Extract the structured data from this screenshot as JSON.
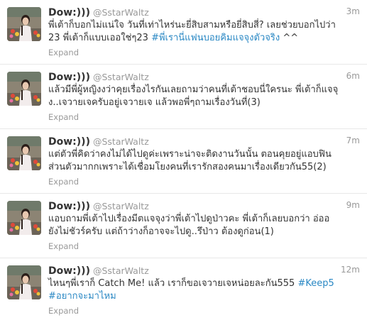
{
  "tweets": [
    {
      "fullname": "Dow:)))",
      "username": "@SstarWaltz",
      "time": "3m",
      "text_line1": "พี่เต้าก็บอกไม่แน่ใจ วันที่เท่าไหร่นะยี่สิบสามหรือยี่สิบสี่? เลยช่วยบอกไปว่า",
      "text_line2": "23 พี่เต้าก็แบบเออใช่ๆ23 ",
      "hashtag": "#พี่เรานี่แฟนบอยคิมแจจุงตัวจริง",
      "text_after": " ^^",
      "expand": "Expand"
    },
    {
      "fullname": "Dow:)))",
      "username": "@SstarWaltz",
      "time": "6m",
      "text_line1": "แล้วมีพี่ผู้หญิงงว่าคุยเรื่องไรกันเลยถามว่าคนที่เต้าชอบนี่ใครนะ พี่เต้าก็แจจุ",
      "text_line2": "ง..เจวายเจครับอยู่เจวายเจ แล้วพอพี่ๆถามเรื่องวันที่(3)",
      "expand": "Expand"
    },
    {
      "fullname": "Dow:)))",
      "username": "@SstarWaltz",
      "time": "7m",
      "text_line1": "แต่ตัวพี่คิดว่าคงไม่ได้ไปดูค่ะเพราะน่าจะติดงานวันนั้น ตอนคุยอยู่แอบฟิน",
      "text_line2": "ส่วนตัวมากกเพราะได้เชื่อมโยงคนที่เรารักสองคนมาเรื่องเดียวกัน55(2)",
      "expand": "Expand"
    },
    {
      "fullname": "Dow:)))",
      "username": "@SstarWaltz",
      "time": "9m",
      "text_line1": "แอบถามพี่เต้าไปเรื่องมีตแจจุงว่าพี่เต้าไปดูป่าวคะ พี่เต้าก็เลยบอกว่า อ่ออ",
      "text_line2": "ยังไม่ชัวร์ครับ แต่ถ้าว่างก็อาจจะไปดู..รึป่าว ต้องดูก่อน(1)",
      "expand": "Expand"
    },
    {
      "fullname": "Dow:)))",
      "username": "@SstarWaltz",
      "time": "12m",
      "text_line1": "ไหนๆพี่เราก็ Catch Me! แล้ว เราก็ขอเจวายเจหน่อยละกัน555 ",
      "hashtag1": "#Keep5",
      "hashtag2": "#อยากจะมาไหม",
      "expand": "Expand"
    }
  ],
  "colors": {
    "text": "#333333",
    "muted": "#999999",
    "link": "#2a88c4",
    "divider": "#e8e8e8"
  }
}
